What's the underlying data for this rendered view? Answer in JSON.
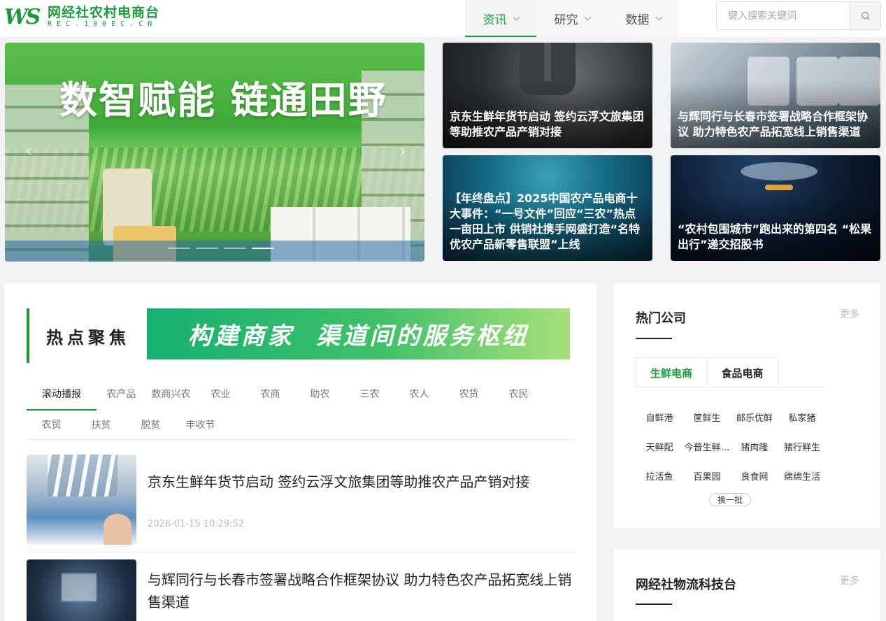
{
  "logo": {
    "mark": "WS",
    "name": "网经社农村电商台",
    "sub": "REC.100EC.CN"
  },
  "nav": [
    {
      "label": "资讯"
    },
    {
      "label": "研究"
    },
    {
      "label": "数据"
    }
  ],
  "search": {
    "placeholder": "键入搜索关键词",
    "value": ""
  },
  "banner": {
    "title": "数智赋能 链通田野"
  },
  "cards": [
    {
      "caption": "京东生鲜年货节启动 签约云浮文旅集团等助推农产品产销对接"
    },
    {
      "caption": "与辉同行与长春市签署战略合作框架协议 助力特色农产品拓宽线上销售渠道"
    },
    {
      "caption": "【年终盘点】2025中国农产品电商十大事件：“一号文件”回应“三农”热点 一亩田上市 供销社携手网盛打造“名特优农产品新零售联盟”上线"
    },
    {
      "caption": "“农村包围城市”跑出来的第四名 “松果出行”递交招股书"
    }
  ],
  "focus": {
    "label": "热点聚焦",
    "slogan": "构建商家  渠道间的服务枢纽"
  },
  "tabs": {
    "row1": [
      "滚动播报",
      "农产品",
      "数商兴农",
      "农业",
      "农商",
      "助农",
      "三农",
      "农人",
      "农货",
      "农民"
    ],
    "row2": [
      "农贸",
      "扶贫",
      "脱贫",
      "丰收节"
    ]
  },
  "news": [
    {
      "title": "京东生鲜年货节启动 签约云浮文旅集团等助推农产品产销对接",
      "date": "2026-01-15 10:29:52"
    },
    {
      "title": "与辉同行与长春市签署战略合作框架协议 助力特色农产品拓宽线上销售渠道",
      "date": ""
    }
  ],
  "hot_companies": {
    "title": "热门公司",
    "more": "更多",
    "tabs": [
      "生鲜电商",
      "食品电商"
    ],
    "items": [
      "自鲜港",
      "筐鲜生",
      "邮乐优鲜",
      "私家猪",
      "天鲜配",
      "今普生鲜…",
      "猪肉隆",
      "猪行鲜生",
      "拉活鱼",
      "百果园",
      "良食网",
      "绵绵生活"
    ],
    "refresh": "换一批"
  },
  "logistics": {
    "title": "网经社物流科技台",
    "more": "更多"
  },
  "colors": {
    "brand": "#1a9a3a",
    "background": "#f1f2f4"
  }
}
